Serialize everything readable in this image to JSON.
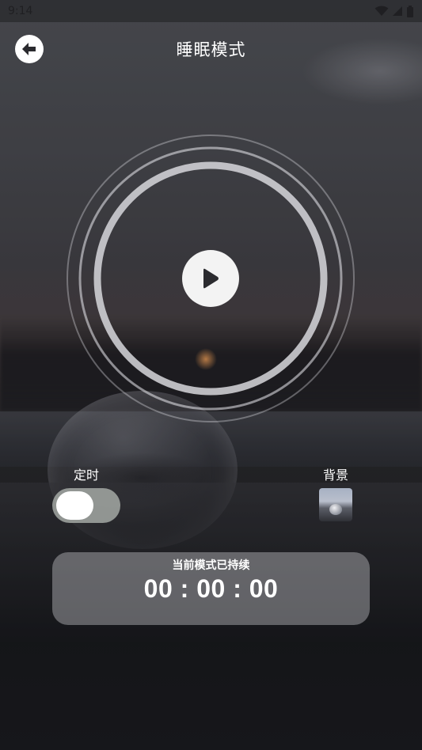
{
  "status_bar": {
    "time": "9:14",
    "icons": [
      "wifi-icon",
      "signal-icon",
      "battery-icon"
    ]
  },
  "header": {
    "back_icon": "arrow-left-icon",
    "title": "睡眠模式"
  },
  "player": {
    "play_icon": "play-icon"
  },
  "controls": {
    "timer_label": "定时",
    "timer_enabled": false,
    "background_label": "背景"
  },
  "duration": {
    "label": "当前模式已持续",
    "value": "00 : 00 : 00"
  },
  "colors": {
    "ring": "#c9c9cc",
    "play_button": "#f3f3f3",
    "toggle_track": "#b4bab4",
    "card": "#c8c8cd"
  }
}
